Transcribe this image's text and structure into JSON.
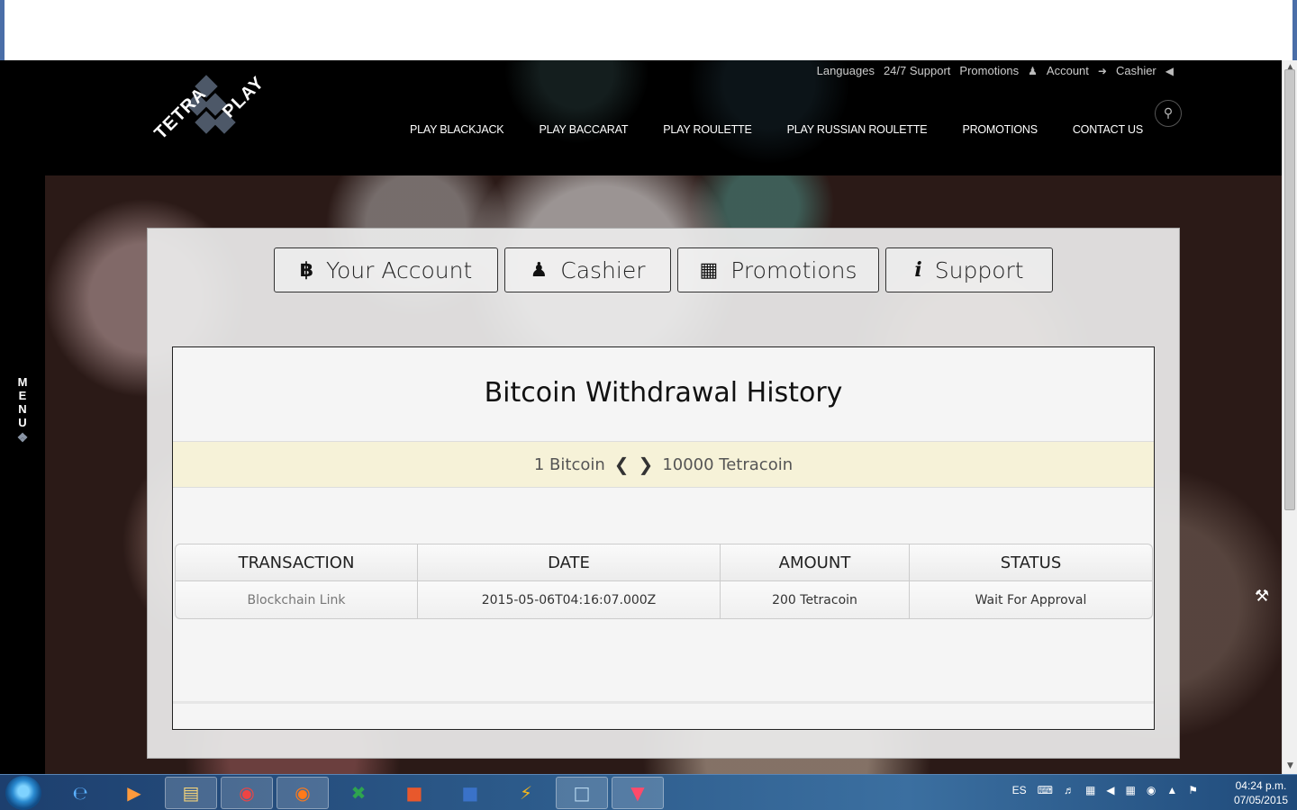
{
  "utility_nav": {
    "languages": "Languages",
    "support": "24/7 Support",
    "promotions": "Promotions",
    "account": "Account",
    "cashier": "Cashier"
  },
  "main_nav": [
    "PLAY BLACKJACK",
    "PLAY BACCARAT",
    "PLAY ROULETTE",
    "PLAY RUSSIAN ROULETTE",
    "PROMOTIONS",
    "CONTACT US"
  ],
  "logo": {
    "line1": "TETRA",
    "line2": "PLAY"
  },
  "side_menu": {
    "label": "MENU"
  },
  "tabs": {
    "account": {
      "label": "Your Account",
      "icon": "bitcoin-icon"
    },
    "cashier": {
      "label": "Cashier",
      "icon": "user-icon"
    },
    "promotions": {
      "label": "Promotions",
      "icon": "gift-icon"
    },
    "support": {
      "label": "Support",
      "icon": "info-icon"
    }
  },
  "card": {
    "title": "Bitcoin Withdrawal History",
    "rate_left": "1 Bitcoin",
    "rate_right": "10000 Tetracoin"
  },
  "table": {
    "headers": [
      "TRANSACTION",
      "DATE",
      "AMOUNT",
      "STATUS"
    ],
    "rows": [
      [
        "Blockchain Link",
        "2015-05-06T04:16:07.000Z",
        "200 Tetracoin",
        "Wait For Approval"
      ]
    ]
  },
  "taskbar": {
    "lang": "ES",
    "time": "04:24 p.m.",
    "date": "07/05/2015"
  },
  "colors": {
    "rate_bg": "#f6f2d8",
    "taskbar": "#2c5a8a"
  }
}
